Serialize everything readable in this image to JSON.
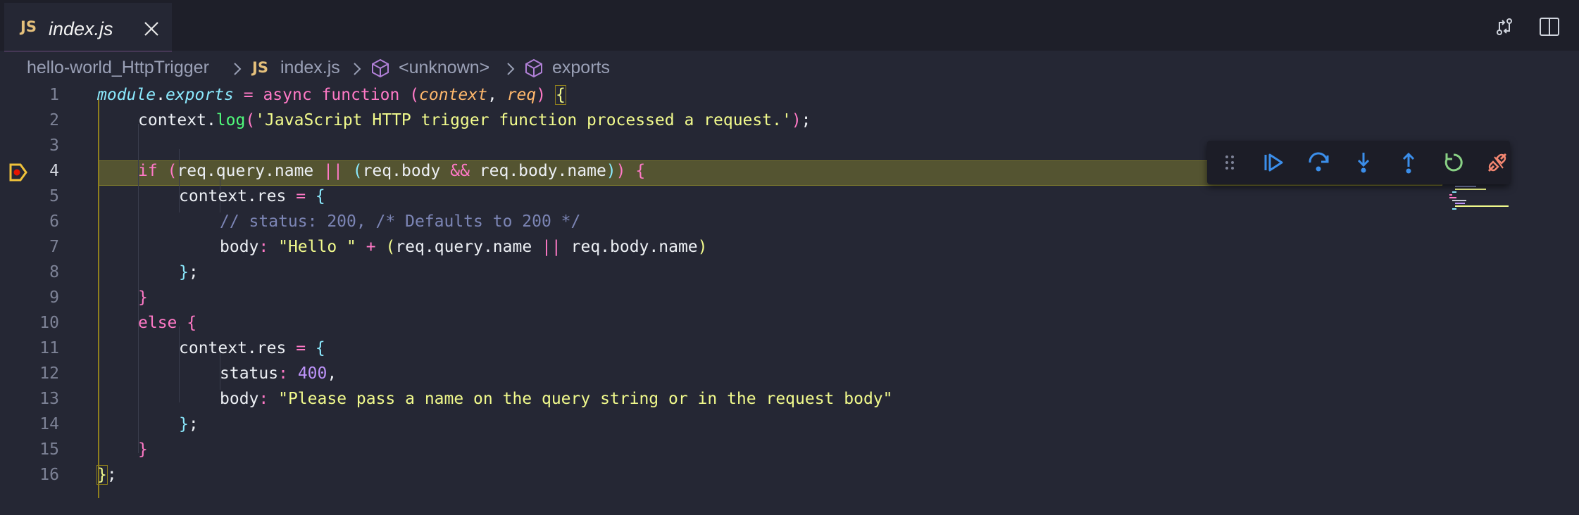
{
  "tab": {
    "icon": "JS",
    "label": "index.js"
  },
  "breadcrumb": {
    "folder": "hello-world_HttpTrigger",
    "file_icon": "JS",
    "file": "index.js",
    "symbol1": "<unknown>",
    "symbol2": "exports"
  },
  "editor": {
    "line_numbers": [
      "1",
      "2",
      "3",
      "4",
      "5",
      "6",
      "7",
      "8",
      "9",
      "10",
      "11",
      "12",
      "13",
      "14",
      "15",
      "16"
    ],
    "current_line": 4
  },
  "code": {
    "l1": [
      "module",
      ".",
      "exports",
      " = ",
      "async",
      " ",
      "function",
      " ",
      "(",
      "context",
      ", ",
      "req",
      ")",
      " ",
      "{"
    ],
    "l2": [
      "context",
      ".",
      "log",
      "(",
      "'JavaScript HTTP trigger function processed a request.'",
      ")",
      ";"
    ],
    "l4": [
      "if",
      " ",
      "(",
      "req.query.name",
      " ",
      "||",
      " ",
      "(",
      "req.body",
      " ",
      "&&",
      " ",
      "req.body.name",
      ")",
      ")",
      " ",
      "{"
    ],
    "l5": [
      "context.res",
      " ",
      "=",
      " ",
      "{"
    ],
    "l6": [
      "// status: 200, /* Defaults to 200 */"
    ],
    "l7": [
      "body",
      ":",
      " ",
      "\"Hello \"",
      " ",
      "+",
      " ",
      "(",
      "req.query.name",
      " ",
      "||",
      " ",
      "req.body.name",
      ")"
    ],
    "l8": [
      "}",
      ";"
    ],
    "l9": [
      "}"
    ],
    "l10": [
      "else",
      " ",
      "{"
    ],
    "l11": [
      "context.res",
      " ",
      "=",
      " ",
      "{"
    ],
    "l12": [
      "status",
      ":",
      " ",
      "400",
      ","
    ],
    "l13": [
      "body",
      ":",
      " ",
      "\"Please pass a name on the query string or in the request body\""
    ],
    "l14": [
      "}",
      ";"
    ],
    "l15": [
      "}"
    ],
    "l16": [
      "}",
      ";"
    ]
  },
  "debug_toolbar": {
    "buttons": [
      "drag-handle",
      "continue",
      "step-over",
      "step-into",
      "step-out",
      "restart",
      "disconnect"
    ]
  },
  "colors": {
    "editor_bg": "#252734",
    "tabbar_bg": "#1e1f29",
    "current_line_bg": "#545431",
    "debug_blue": "#3b8eea",
    "restart_green": "#89d185",
    "disconnect_red": "#f48771"
  }
}
